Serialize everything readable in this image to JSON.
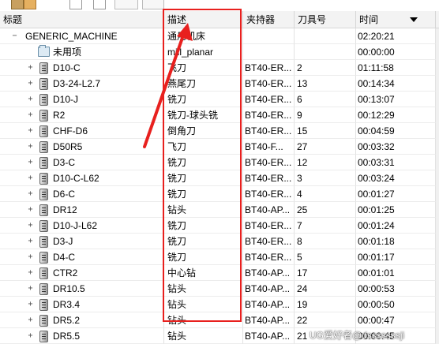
{
  "columns": {
    "title": "标题",
    "description": "描述",
    "holder": "夹持器",
    "tool_number": "刀具号",
    "time": "时间"
  },
  "rows": [
    {
      "title": "GENERIC_MACHINE",
      "description": "通用机床",
      "holder": "",
      "tool_number": "",
      "time": "02:20:21"
    },
    {
      "title": "未用项",
      "description": "mill_planar",
      "holder": "",
      "tool_number": "",
      "time": "00:00:00"
    },
    {
      "title": "D10-C",
      "description": "飞刀",
      "holder": "BT40-ER...",
      "tool_number": "2",
      "time": "01:11:58"
    },
    {
      "title": "D3-24-L2.7",
      "description": "燕尾刀",
      "holder": "BT40-ER...",
      "tool_number": "13",
      "time": "00:14:34"
    },
    {
      "title": "D10-J",
      "description": "铣刀",
      "holder": "BT40-ER...",
      "tool_number": "6",
      "time": "00:13:07"
    },
    {
      "title": "R2",
      "description": "铣刀-球头铣",
      "holder": "BT40-ER...",
      "tool_number": "9",
      "time": "00:12:29"
    },
    {
      "title": "CHF-D6",
      "description": "倒角刀",
      "holder": "BT40-ER...",
      "tool_number": "15",
      "time": "00:04:59"
    },
    {
      "title": "D50R5",
      "description": "飞刀",
      "holder": "BT40-F...",
      "tool_number": "27",
      "time": "00:03:32"
    },
    {
      "title": "D3-C",
      "description": "铣刀",
      "holder": "BT40-ER...",
      "tool_number": "12",
      "time": "00:03:31"
    },
    {
      "title": "D10-C-L62",
      "description": "铣刀",
      "holder": "BT40-ER...",
      "tool_number": "3",
      "time": "00:03:24"
    },
    {
      "title": "D6-C",
      "description": "铣刀",
      "holder": "BT40-ER...",
      "tool_number": "4",
      "time": "00:01:27"
    },
    {
      "title": "DR12",
      "description": "钻头",
      "holder": "BT40-AP...",
      "tool_number": "25",
      "time": "00:01:25"
    },
    {
      "title": "D10-J-L62",
      "description": "铣刀",
      "holder": "BT40-ER...",
      "tool_number": "7",
      "time": "00:01:24"
    },
    {
      "title": "D3-J",
      "description": "铣刀",
      "holder": "BT40-ER...",
      "tool_number": "8",
      "time": "00:01:18"
    },
    {
      "title": "D4-C",
      "description": "铣刀",
      "holder": "BT40-ER...",
      "tool_number": "5",
      "time": "00:01:17"
    },
    {
      "title": "CTR2",
      "description": "中心钻",
      "holder": "BT40-AP...",
      "tool_number": "17",
      "time": "00:01:01"
    },
    {
      "title": "DR10.5",
      "description": "钻头",
      "holder": "BT40-AP...",
      "tool_number": "24",
      "time": "00:00:53"
    },
    {
      "title": "DR3.4",
      "description": "钻头",
      "holder": "BT40-AP...",
      "tool_number": "19",
      "time": "00:00:50"
    },
    {
      "title": "DR5.2",
      "description": "钻头",
      "holder": "BT40-AP...",
      "tool_number": "22",
      "time": "00:00:47"
    },
    {
      "title": "DR5.5",
      "description": "钻头",
      "holder": "BT40-AP...",
      "tool_number": "21",
      "time": "00:00:45"
    }
  ],
  "watermark": "UG爱好者@dsssssssji",
  "colors": {
    "highlight_box": "#e8201e",
    "header_bg": "#f3f3f3",
    "grid_line": "#e2e2e2"
  }
}
